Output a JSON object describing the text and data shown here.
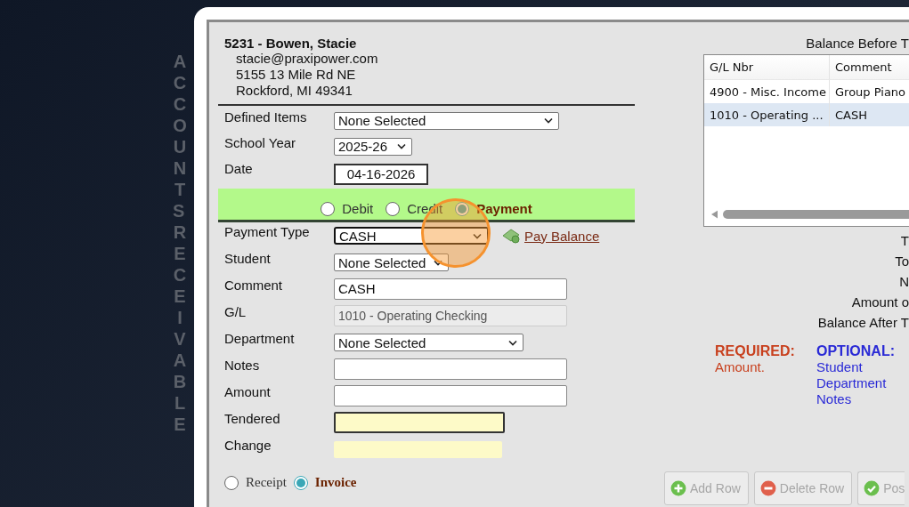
{
  "sidebar_label": "ACCOUNTS RECEIVABLE",
  "customer": {
    "title": "5231 - Bowen, Stacie",
    "email": "stacie@praxipower.com",
    "address_lines": [
      "5155 13 Mile Rd NE",
      "Rockford, MI 49341"
    ]
  },
  "fields": [
    {
      "kind": "select",
      "label": "Defined Items",
      "value": "None Selected"
    },
    {
      "kind": "select",
      "label": "School Year",
      "value": "2025-26"
    },
    {
      "kind": "date",
      "label": "Date",
      "value": "04-16-2026"
    }
  ],
  "transaction_types": [
    {
      "label": "Debit",
      "selected": false
    },
    {
      "label": "Credit",
      "selected": false
    },
    {
      "label": "Payment",
      "selected": true
    }
  ],
  "payment_fields": [
    {
      "kind": "select",
      "label": "Payment Type",
      "value": "CASH",
      "focused": true,
      "link": "Pay Balance"
    },
    {
      "kind": "select",
      "label": "Student",
      "value": "None Selected",
      "focused": false
    },
    {
      "kind": "text",
      "label": "Comment",
      "value": "CASH"
    },
    {
      "kind": "readonly",
      "label": "G/L",
      "value": "1010 - Operating Checking"
    },
    {
      "kind": "select",
      "label": "Department",
      "value": "None Selected",
      "focused": false
    },
    {
      "kind": "text",
      "label": "Notes"
    },
    {
      "kind": "text",
      "label": "Amount"
    },
    {
      "kind": "highlight",
      "label": "Tendered",
      "focused": true
    },
    {
      "kind": "highlight",
      "label": "Change",
      "focused": false
    }
  ],
  "document_types": [
    {
      "label": "Receipt",
      "selected": false
    },
    {
      "label": "Invoice",
      "selected": true
    }
  ],
  "grid": {
    "title": "Balance Before T",
    "columns": [
      "G/L Nbr",
      "Comment"
    ],
    "rows": [
      {
        "cells": [
          "4900 - Misc. Income",
          "Group Piano"
        ],
        "selected": false
      },
      {
        "cells": [
          "1010 - Operating ...",
          "CASH"
        ],
        "selected": true
      }
    ]
  },
  "totals": [
    "T",
    "To",
    "N",
    "Amount o",
    "Balance After T"
  ],
  "required": {
    "title": "REQUIRED:",
    "items": [
      "Amount."
    ]
  },
  "optional": {
    "title": "OPTIONAL:",
    "items": [
      "Student",
      "Department",
      "Notes"
    ]
  },
  "buttons": [
    {
      "kind": "add",
      "label": "Add Row",
      "disabled": true
    },
    {
      "kind": "delete",
      "label": "Delete Row",
      "disabled": true
    },
    {
      "kind": "post",
      "label": "Pos",
      "disabled": true
    }
  ]
}
